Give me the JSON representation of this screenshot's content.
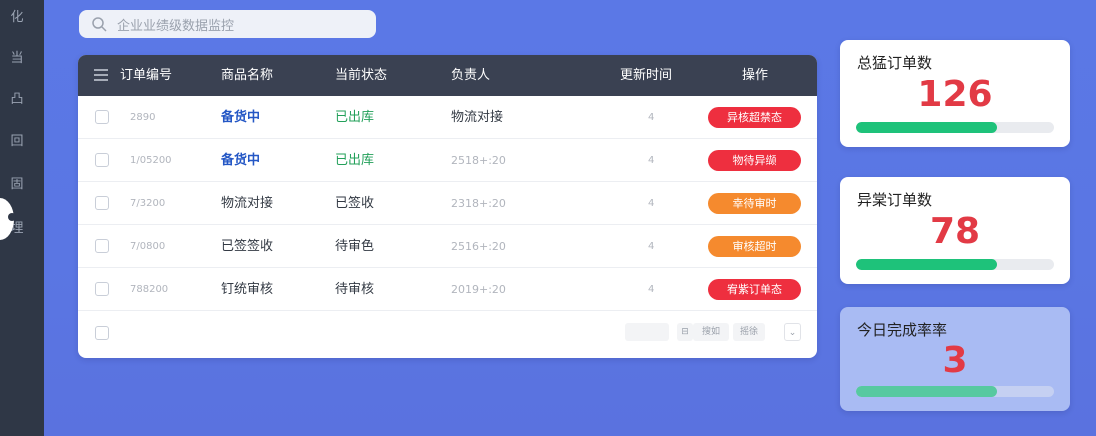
{
  "sidebar": {
    "items": [
      {
        "glyph": "化"
      },
      {
        "glyph": "当"
      },
      {
        "glyph": "凸"
      },
      {
        "glyph": "回"
      },
      {
        "glyph": "固"
      },
      {
        "glyph": "埋"
      }
    ]
  },
  "search": {
    "placeholder": "企业业绩级数据监控"
  },
  "table": {
    "headers": {
      "id": "订单编号",
      "name": "商品名称",
      "status": "当前状态",
      "owner": "负责人",
      "time": "更新时间",
      "action": "操作"
    },
    "rows": [
      {
        "id": "2890",
        "name": "备货中",
        "status": "已出库",
        "owner": "物流对接",
        "time": "4",
        "action": "异核超禁态",
        "action_color": "#ee2f3f"
      },
      {
        "id": "1/05200",
        "name": "备货中",
        "status": "已出库",
        "owner": "2518+:20",
        "time": "4",
        "action": "物待异缬",
        "action_color": "#ee2f3f"
      },
      {
        "id": "7/3200",
        "name": "物流对接",
        "status": "已签收",
        "owner": "2318+:20",
        "time": "4",
        "action": "幸待审时",
        "action_color": "#f58a2e"
      },
      {
        "id": "7/0800",
        "name": "已签签收",
        "status": "待审色",
        "owner": "2516+:20",
        "time": "4",
        "action": "审核超时",
        "action_color": "#f58a2e"
      },
      {
        "id": "788200",
        "name": "钉统审核",
        "status": "待审核",
        "owner": "2019+:20",
        "time": "4",
        "action": "宥紫订单态",
        "action_color": "#ee2f3f"
      }
    ],
    "footer": {
      "prev": "搜如",
      "next": "摇徐"
    }
  },
  "stats": [
    {
      "title": "总猛订单数",
      "value": "126",
      "progress": 0.71
    },
    {
      "title": "异棠订单数",
      "value": "78",
      "progress": 0.71
    },
    {
      "title": "今日完成率率",
      "value": "3",
      "progress": 0.71
    }
  ],
  "colors": {
    "background": "#5b78e6",
    "sidebar": "#2f3746",
    "table_header": "#3a4152",
    "accent_red": "#e23a45",
    "progress_green": "#1ec27a"
  }
}
